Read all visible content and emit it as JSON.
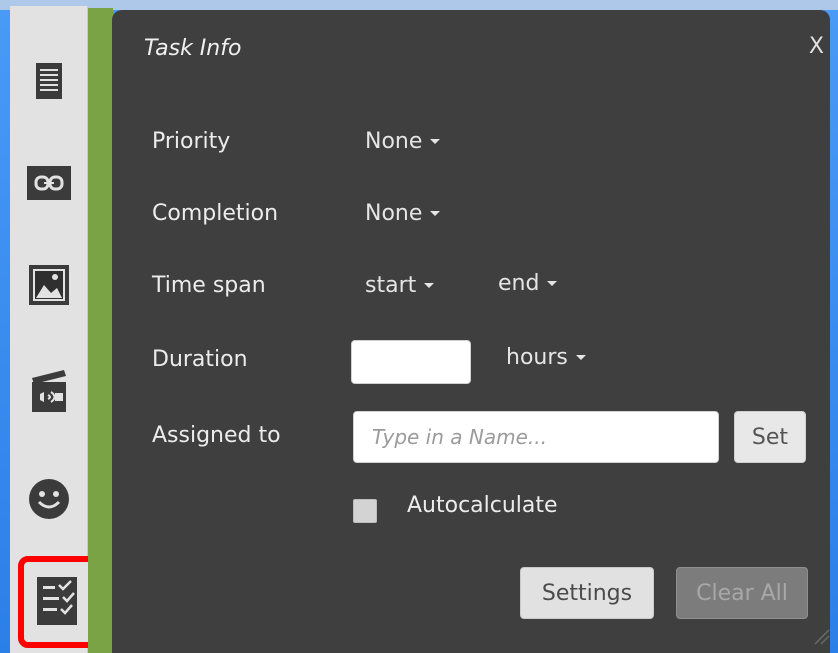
{
  "panel": {
    "title": "Task Info",
    "close_label": "X"
  },
  "toolbar": {
    "items": [
      {
        "icon": "notes-icon"
      },
      {
        "icon": "link-icon"
      },
      {
        "icon": "image-icon"
      },
      {
        "icon": "video-icon"
      },
      {
        "icon": "smiley-icon"
      },
      {
        "icon": "task-checklist-icon"
      }
    ]
  },
  "fields": {
    "priority_label": "Priority",
    "priority_value": "None",
    "completion_label": "Completion",
    "completion_value": "None",
    "timespan_label": "Time span",
    "timespan_start": "start",
    "timespan_end": "end",
    "duration_label": "Duration",
    "duration_unit": "hours",
    "assigned_label": "Assigned to",
    "assigned_placeholder": "Type in a Name...",
    "set_label": "Set",
    "autocalculate_label": "Autocalculate"
  },
  "actions": {
    "settings_label": "Settings",
    "clear_all_label": "Clear All"
  },
  "colors": {
    "panel_background": "#3f3f3f",
    "highlight": "#ff0000",
    "accent_green": "#7aa346"
  }
}
